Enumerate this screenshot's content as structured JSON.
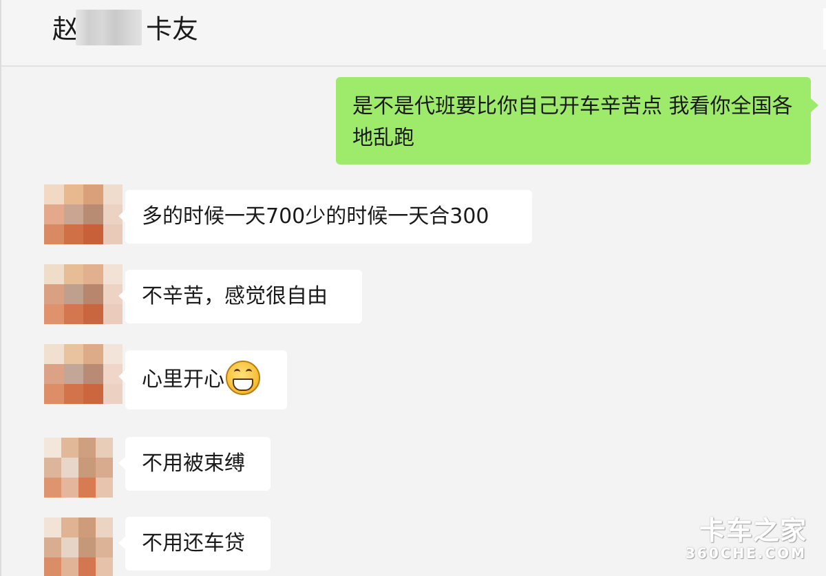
{
  "chat": {
    "title_prefix": "赵",
    "title_suffix": "卡友"
  },
  "messages": [
    {
      "side": "right",
      "text": "是不是代班要比你自己开车辛苦点 我看你全国各地乱跑"
    },
    {
      "side": "left",
      "text": "多的时候一天700少的时候一天合300"
    },
    {
      "side": "left",
      "text": "不辛苦，感觉很自由"
    },
    {
      "side": "left",
      "text": "心里开心",
      "emoji": "grinning-face-icon"
    },
    {
      "side": "left",
      "text": "不用被束缚"
    },
    {
      "side": "left",
      "text": "不用还车贷"
    }
  ],
  "watermark": {
    "cn": "卡车之家",
    "en": "360CHE.COM"
  },
  "colors": {
    "sent_bubble": "#9eea6a",
    "received_bubble": "#ffffff",
    "background": "#f3f3f3"
  }
}
